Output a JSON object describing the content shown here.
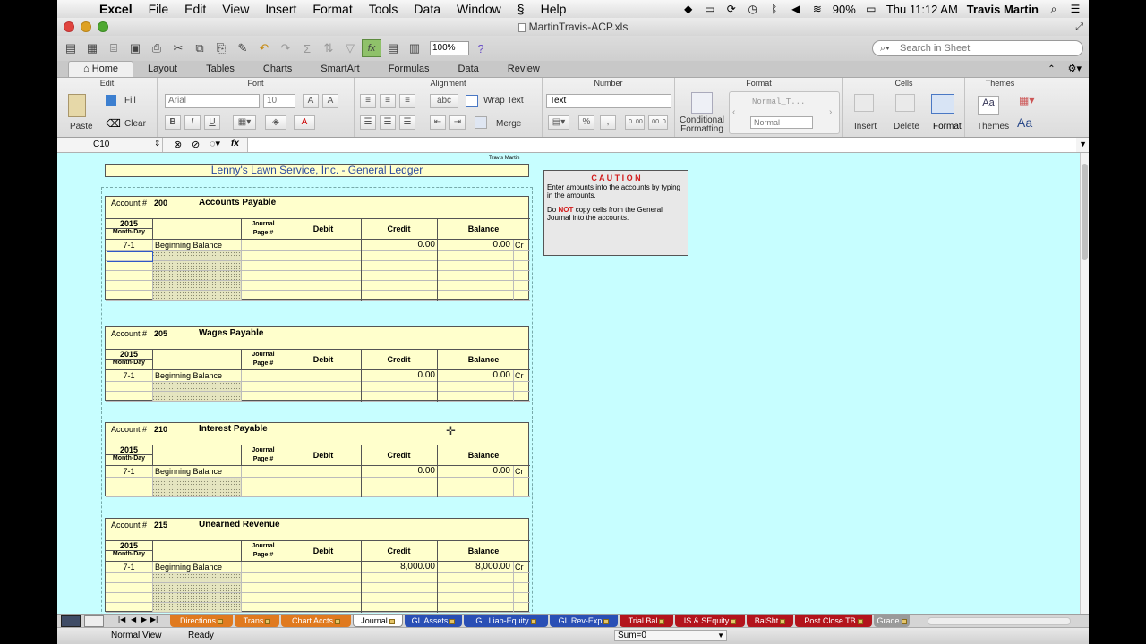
{
  "menubar": {
    "app": "Excel",
    "items": [
      "File",
      "Edit",
      "View",
      "Insert",
      "Format",
      "Tools",
      "Data",
      "Window",
      "Help"
    ],
    "battery": "90%",
    "clock": "Thu 11:12 AM",
    "user": "Travis Martin"
  },
  "window": {
    "title": "MartinTravis-ACP.xls"
  },
  "toolbar": {
    "zoom": "100%",
    "search_placeholder": "Search in Sheet"
  },
  "ribbon": {
    "tabs": [
      "Home",
      "Layout",
      "Tables",
      "Charts",
      "SmartArt",
      "Formulas",
      "Data",
      "Review"
    ],
    "groups": {
      "edit": "Edit",
      "font": "Font",
      "alignment": "Alignment",
      "number": "Number",
      "format": "Format",
      "cells": "Cells",
      "themes": "Themes"
    },
    "paste": "Paste",
    "fill": "Fill",
    "clear": "Clear",
    "font_name": "Arial",
    "font_size": "10",
    "wrap_text": "Wrap Text",
    "merge": "Merge",
    "number_format": "Text",
    "conditional": "Conditional Formatting",
    "style_normal_t": "Normal_T...",
    "style_normal": "Normal",
    "insert": "Insert",
    "delete": "Delete",
    "format_btn": "Format",
    "themes_btn": "Themes",
    "abc": "abc",
    "pct": "%",
    "comma": ",",
    "dec1": ".0 .00",
    "dec2": ".00 .0",
    "bold": "B",
    "italic": "I",
    "underline": "U",
    "font_a1": "A",
    "font_a2": "A",
    "font_color": "A",
    "themes_aa": "Aa"
  },
  "formula_bar": {
    "cell": "C10",
    "fx": "fx"
  },
  "sheet": {
    "author": "Travis Martin",
    "title": "Lenny's Lawn Service, Inc.  -  General Ledger",
    "caution": {
      "title": "C A U T I O N",
      "line1": "Enter amounts into the accounts by typing in the amounts.",
      "line2a": "Do ",
      "line2b": "NOT",
      "line2c": " copy cells from the General Journal into the accounts."
    },
    "col_labels": {
      "acct": "Account #",
      "year": "2015",
      "monthday": "Month-Day",
      "journal": "Journal",
      "page": "Page #",
      "debit": "Debit",
      "credit": "Credit",
      "balance": "Balance"
    },
    "accounts": [
      {
        "no": "200",
        "name": "Accounts Payable",
        "date": "7-1",
        "desc": "Beginning Balance",
        "credit": "0.00",
        "balance": "0.00",
        "side": "Cr"
      },
      {
        "no": "205",
        "name": "Wages Payable",
        "date": "7-1",
        "desc": "Beginning Balance",
        "credit": "0.00",
        "balance": "0.00",
        "side": "Cr"
      },
      {
        "no": "210",
        "name": "Interest Payable",
        "date": "7-1",
        "desc": "Beginning Balance",
        "credit": "0.00",
        "balance": "0.00",
        "side": "Cr"
      },
      {
        "no": "215",
        "name": "Unearned Revenue",
        "date": "7-1",
        "desc": "Beginning Balance",
        "credit": "8,000.00",
        "balance": "8,000.00",
        "side": "Cr"
      }
    ]
  },
  "sheet_tabs": [
    {
      "label": "Directions",
      "color": "#e07a1f"
    },
    {
      "label": "Trans",
      "color": "#e07a1f"
    },
    {
      "label": "Chart Accts",
      "color": "#e07a1f"
    },
    {
      "label": "Journal",
      "color": "#ffffff"
    },
    {
      "label": "GL Assets",
      "color": "#2a4fb5"
    },
    {
      "label": "GL Liab-Equity",
      "color": "#2a4fb5"
    },
    {
      "label": "GL Rev-Exp",
      "color": "#2a4fb5"
    },
    {
      "label": "Trial Bal",
      "color": "#b3141c"
    },
    {
      "label": "IS & SEquity",
      "color": "#b3141c"
    },
    {
      "label": "BalSht",
      "color": "#b3141c"
    },
    {
      "label": "Post Close TB",
      "color": "#b3141c"
    },
    {
      "label": "Grade",
      "color": "#9a9a9a"
    }
  ],
  "status": {
    "view": "Normal View",
    "state": "Ready",
    "sum": "Sum=0"
  }
}
